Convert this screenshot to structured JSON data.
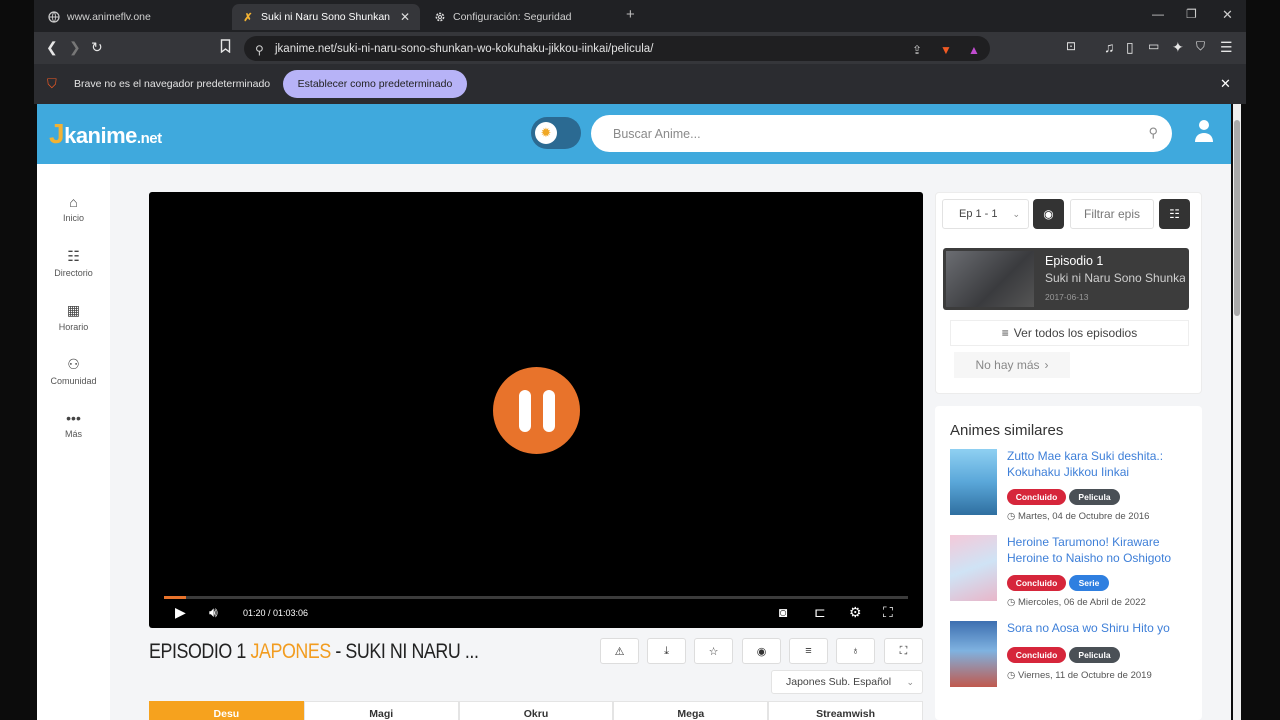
{
  "browser": {
    "tabs": [
      {
        "label": "www.animeflv.one"
      },
      {
        "label": "Suki ni Naru Sono Shunkan wo..."
      },
      {
        "label": "Configuración: Seguridad"
      }
    ],
    "url": "jkanime.net/suki-ni-naru-sono-shunkan-wo-kokuhaku-jikkou-iinkai/pelicula/",
    "infobar_text": "Brave no es el navegador predeterminado",
    "set_default_label": "Establecer como predeterminado"
  },
  "site": {
    "logo_j": "J",
    "logo_main": "kanime",
    "logo_tld": ".net",
    "search_placeholder": "Buscar Anime...",
    "sidebar": [
      {
        "icon": "home-icon",
        "label": "Inicio"
      },
      {
        "icon": "directory-icon",
        "label": "Directorio"
      },
      {
        "icon": "calendar-icon",
        "label": "Horario"
      },
      {
        "icon": "community-icon",
        "label": "Comunidad"
      },
      {
        "icon": "more-icon",
        "label": "Más"
      }
    ]
  },
  "player": {
    "time": "01:20 / 01:03:06",
    "progress": 0.03
  },
  "episode": {
    "title_prefix": "EPISODIO 1",
    "title_lang": "JAPONES",
    "title_rest": "- SUKI NI NARU ...",
    "language": "Japones Sub. Español",
    "servers": [
      "Desu",
      "Magi",
      "Okru",
      "Mega",
      "Streamwish"
    ]
  },
  "episodes_panel": {
    "range": "Ep 1 - 1",
    "filter_placeholder": "Filtrar epis",
    "ep_name": "Episodio 1",
    "ep_sub": "Suki ni Naru Sono Shunkan wo",
    "ep_date": "2017-06-13",
    "see_all": "Ver todos los episodios",
    "no_more": "No hay más"
  },
  "similar": {
    "title": "Animes similares",
    "items": [
      {
        "name": "Zutto Mae kara Suki deshita.: Kokuhaku Jikkou Iinkai",
        "status": "Concluido",
        "type": "Pelicula",
        "date": "Martes, 04 de Octubre de 2016"
      },
      {
        "name": "Heroine Tarumono! Kiraware Heroine to Naisho no Oshigoto",
        "status": "Concluido",
        "type": "Serie",
        "date": "Miercoles, 06 de Abril de 2022"
      },
      {
        "name": "Sora no Aosa wo Shiru Hito yo",
        "status": "Concluido",
        "type": "Pelicula",
        "date": "Viernes, 11 de Octubre de 2019"
      }
    ]
  },
  "colors": {
    "header": "#3fa9dd",
    "accent": "#e8732b",
    "concluido": "#d6263b",
    "pelicula": "#4a5056",
    "serie": "#2f7fe0"
  }
}
